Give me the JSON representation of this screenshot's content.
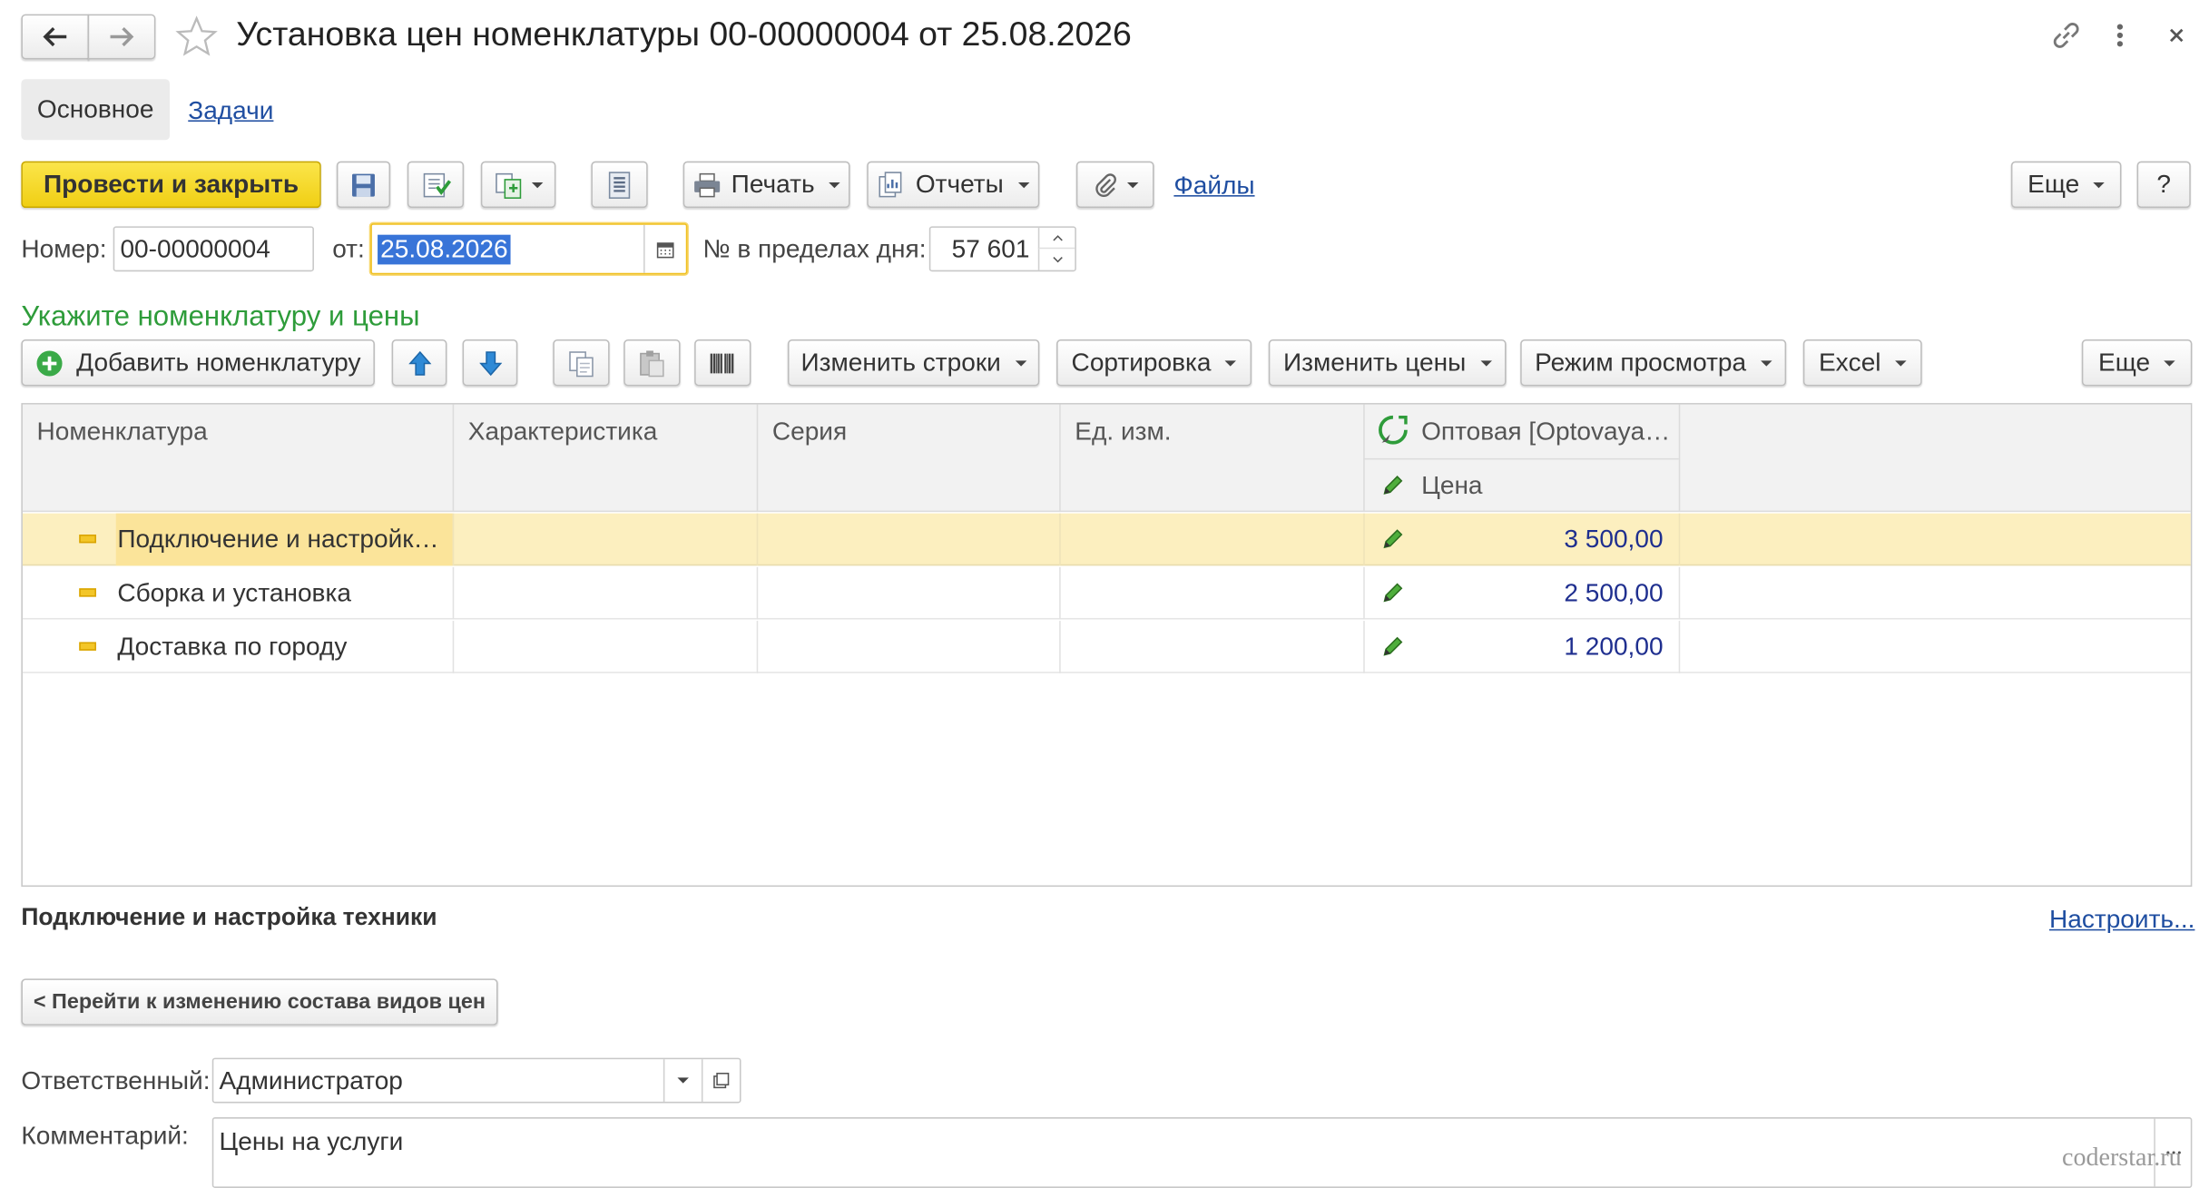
{
  "window": {
    "title": "Установка цен номенклатуры 00-00000004 от 25.08.2026"
  },
  "tabs": [
    {
      "label": "Основное",
      "active": true
    },
    {
      "label": "Задачи",
      "active": false
    }
  ],
  "toolbar": {
    "post_close_label": "Провести и закрыть",
    "print_label": "Печать",
    "reports_label": "Отчеты",
    "files_label": "Файлы",
    "more_label": "Еще",
    "help_label": "?"
  },
  "header_fields": {
    "number_label": "Номер:",
    "number_value": "00-00000004",
    "date_label": "от:",
    "date_value": "25.08.2026",
    "day_number_label": "№ в пределах дня:",
    "day_number_value": "57 601"
  },
  "section_title": "Укажите номенклатуру и цены",
  "table_toolbar": {
    "add_label": "Добавить номенклатуру",
    "change_rows_label": "Изменить строки",
    "sort_label": "Сортировка",
    "change_prices_label": "Изменить цены",
    "view_mode_label": "Режим просмотра",
    "excel_label": "Excel",
    "more_label": "Еще"
  },
  "table": {
    "columns": [
      "Номенклатура",
      "Характеристика",
      "Серия",
      "Ед. изм.",
      "Оптовая [Optovaya…",
      "Цена"
    ],
    "rows": [
      {
        "name": "Подключение и настройк…",
        "price": "3 500,00",
        "selected": true
      },
      {
        "name": "Сборка и установка",
        "price": "2 500,00",
        "selected": false
      },
      {
        "name": "Доставка по городу",
        "price": "1 200,00",
        "selected": false
      }
    ]
  },
  "selected_item_title": "Подключение и настройка техники",
  "configure_link": "Настроить...",
  "go_to_prices_button": "< Перейти к изменению состава видов цен",
  "responsible": {
    "label": "Ответственный:",
    "value": "Администратор"
  },
  "comment": {
    "label": "Комментарий:",
    "value": "Цены на услуги"
  },
  "watermark": "coderstar.ru",
  "colors": {
    "primary_button": "#f8dd2a",
    "section_title": "#2e9c3a",
    "selected_row": "#fcefbf",
    "price_text": "#1f2f8f",
    "link": "#1f4ea1"
  }
}
